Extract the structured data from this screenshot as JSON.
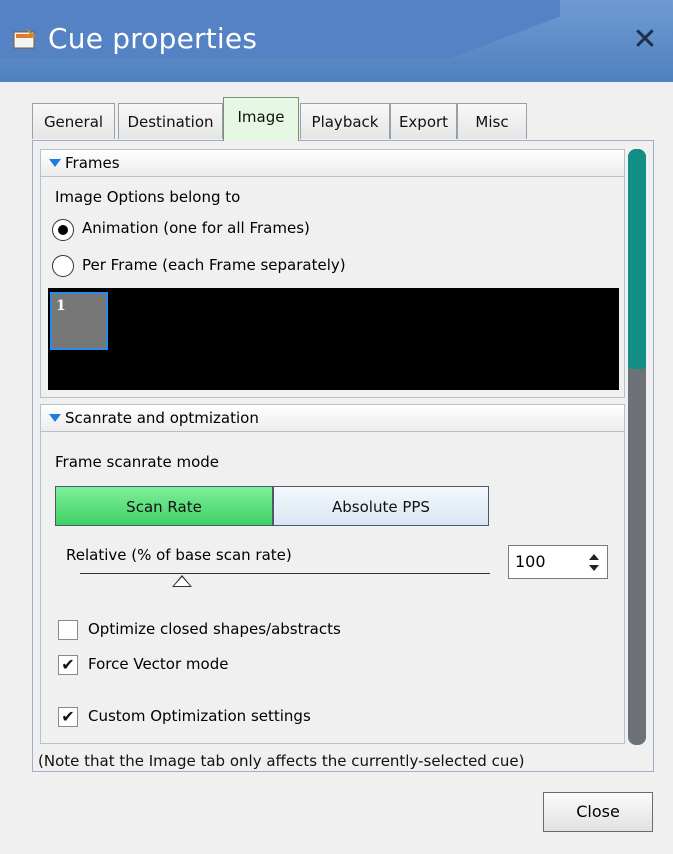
{
  "window": {
    "title": "Cue properties",
    "close_glyph": "✕",
    "icon": "cue-properties-icon"
  },
  "tabs": [
    {
      "label": "General"
    },
    {
      "label": "Destination"
    },
    {
      "label": "Image"
    },
    {
      "label": "Playback"
    },
    {
      "label": "Export"
    },
    {
      "label": "Misc"
    }
  ],
  "active_tab": "Image",
  "frames": {
    "header": "Frames",
    "options_label": "Image Options belong to",
    "radio_animation": "Animation (one for all Frames)",
    "radio_per_frame": "Per Frame (each Frame separately)",
    "selected": "animation",
    "frame_numbers": [
      "1"
    ]
  },
  "scanrate": {
    "header": "Scanrate and optmization",
    "mode_label": "Frame scanrate mode",
    "mode_scan_rate": "Scan Rate",
    "mode_absolute_pps": "Absolute PPS",
    "selected_mode": "Scan Rate",
    "relative_label": "Relative (% of base scan rate)",
    "relative_value": "100",
    "optimize_closed": {
      "label": "Optimize closed shapes/abstracts",
      "checked": false
    },
    "force_vector": {
      "label": "Force Vector mode",
      "checked": true
    },
    "custom_opt": {
      "label": "Custom Optimization settings",
      "checked": true
    }
  },
  "note": "(Note that the Image tab only affects the currently-selected cue)",
  "buttons": {
    "close": "Close"
  },
  "colors": {
    "titlebar": "#5582c4",
    "active_tab": "#e6f7e4",
    "scan_rate_on": "#4fdc70",
    "scroll_thumb": "#138e84"
  }
}
